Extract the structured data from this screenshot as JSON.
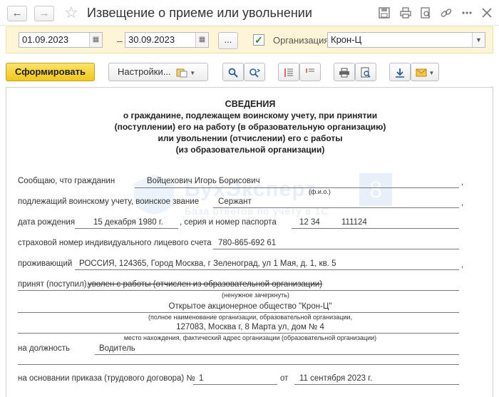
{
  "window": {
    "title": "Извещение о приеме или увольнении"
  },
  "filter": {
    "date_from": "01.09.2023",
    "date_to": "30.09.2023",
    "dash": "–",
    "ellipsis": "...",
    "org_checked": true,
    "org_label": "Организация:",
    "org_value": "Крон-Ц"
  },
  "toolbar": {
    "generate": "Сформировать",
    "settings": "Настройки..."
  },
  "document": {
    "heading": [
      "СВЕДЕНИЯ",
      "о гражданине, подлежащем воинскому учету, при принятии",
      "(поступлении) его на работу (в образовательную организацию)",
      "или увольнении (отчислении) его с работы",
      "(из образовательной организации)"
    ],
    "citizen_label": "Сообщаю, что гражданин",
    "citizen_name": "Войцехович Игорь Борисович",
    "fio_hint": "(ф.и.о.)",
    "rank_label": "подлежащий воинскому учету, воинское звание",
    "rank_value": "Сержант",
    "birth_label": "дата рождения",
    "birth_value": "15 декабря 1980 г.",
    "passport_label": ", серия и номер паспорта",
    "passport_series": "12 34",
    "passport_number": "111124",
    "snils_label": "страховой номер индивидуального лицевого счета",
    "snils_value": "780-865-692 61",
    "address_label": "проживающий",
    "address_value": "РОССИЯ, 124365, Город Москва, г Зеленоград, ул 1 Мая, д. 1, кв. 5",
    "hired_label": "принят (поступил),",
    "dismissed_struck": "уволен с работы (отчислен из образовательной организации)",
    "strike_hint": "(ненужное зачеркнуть)",
    "org_full_name": "Открытое акционерное общество \"Крон-Ц\"",
    "org_name_hint": "(полное наименование организации, образовательной организации,",
    "org_address": "127083, Москва г, 8 Марта ул, дом № 4",
    "org_address_hint": "место нахождения, фактический адрес организации (образовательной организации)",
    "position_label": "на должность",
    "position_value": "Водитель",
    "order_label": "на основании приказа (трудового договора) №",
    "order_number": "1",
    "order_from": "от",
    "order_date": "11 сентября 2023 г.",
    "comma": ","
  },
  "watermark": {
    "main": "БухЭксперт",
    "sub": "База ответов по учёту в 1С",
    "eight": "8"
  }
}
